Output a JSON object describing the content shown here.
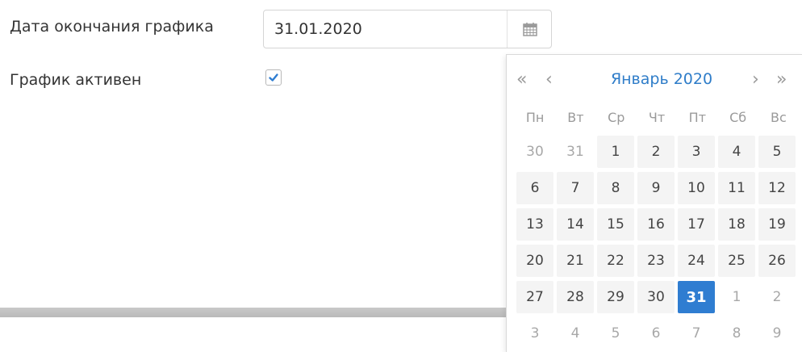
{
  "form": {
    "end_date_label": "Дата окончания графика",
    "end_date_value": "31.01.2020",
    "active_label": "График активен",
    "active_checked": true
  },
  "datepicker": {
    "title": "Январь 2020",
    "prev_year": "«",
    "prev_month": "‹",
    "next_month": "›",
    "next_year": "»",
    "weekdays": [
      "Пн",
      "Вт",
      "Ср",
      "Чт",
      "Пт",
      "Сб",
      "Вс"
    ],
    "weeks": [
      [
        {
          "d": "30",
          "other": true
        },
        {
          "d": "31",
          "other": true
        },
        {
          "d": "1"
        },
        {
          "d": "2"
        },
        {
          "d": "3"
        },
        {
          "d": "4"
        },
        {
          "d": "5"
        }
      ],
      [
        {
          "d": "6"
        },
        {
          "d": "7"
        },
        {
          "d": "8"
        },
        {
          "d": "9"
        },
        {
          "d": "10"
        },
        {
          "d": "11"
        },
        {
          "d": "12"
        }
      ],
      [
        {
          "d": "13"
        },
        {
          "d": "14"
        },
        {
          "d": "15"
        },
        {
          "d": "16"
        },
        {
          "d": "17"
        },
        {
          "d": "18"
        },
        {
          "d": "19"
        }
      ],
      [
        {
          "d": "20"
        },
        {
          "d": "21"
        },
        {
          "d": "22"
        },
        {
          "d": "23"
        },
        {
          "d": "24"
        },
        {
          "d": "25"
        },
        {
          "d": "26"
        }
      ],
      [
        {
          "d": "27"
        },
        {
          "d": "28"
        },
        {
          "d": "29"
        },
        {
          "d": "30"
        },
        {
          "d": "31",
          "selected": true
        },
        {
          "d": "1",
          "other": true
        },
        {
          "d": "2",
          "other": true
        }
      ],
      [
        {
          "d": "3",
          "other": true
        },
        {
          "d": "4",
          "other": true
        },
        {
          "d": "5",
          "other": true
        },
        {
          "d": "6",
          "other": true
        },
        {
          "d": "7",
          "other": true
        },
        {
          "d": "8",
          "other": true
        },
        {
          "d": "9",
          "other": true
        }
      ]
    ]
  },
  "icons": {
    "calendar": "calendar-icon",
    "checkmark": "checkmark-icon"
  },
  "colors": {
    "accent": "#2f7dd1",
    "title": "#2f7dc9"
  }
}
